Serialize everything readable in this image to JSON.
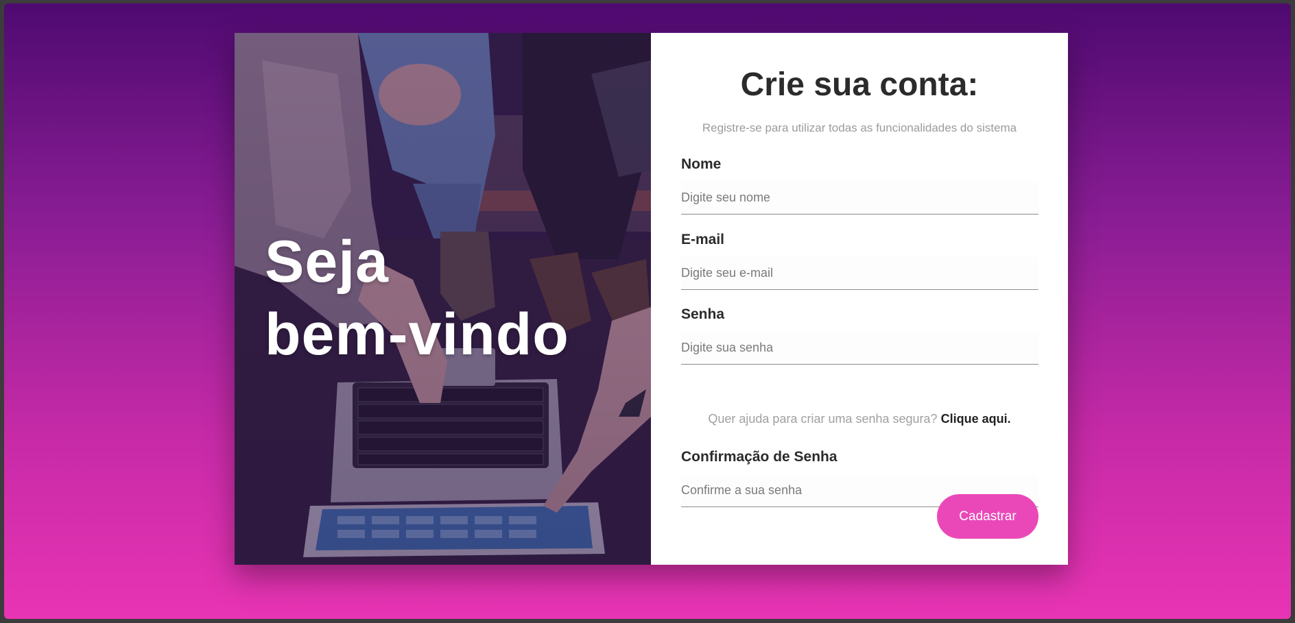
{
  "hero": {
    "title_line1": "Seja",
    "title_line2": "bem-vindo"
  },
  "form": {
    "title": "Crie sua conta:",
    "subtitle": "Registre-se para utilizar todas as funcionalidades do sistema",
    "fields": [
      {
        "label": "Nome",
        "placeholder": "Digite seu nome"
      },
      {
        "label": "E-mail",
        "placeholder": "Digite seu e-mail"
      },
      {
        "label": "Senha",
        "placeholder": "Digite sua senha"
      },
      {
        "label": "Confirmação de Senha",
        "placeholder": "Confirme a sua senha"
      }
    ],
    "help_text": "Quer ajuda para criar uma senha segura?",
    "help_link": "Clique aqui.",
    "submit_label": "Cadastrar"
  },
  "colors": {
    "background_top": "#4e0a70",
    "background_bottom": "#e834b4",
    "button": "#ea48b8",
    "title_text": "#2b2b2b"
  }
}
